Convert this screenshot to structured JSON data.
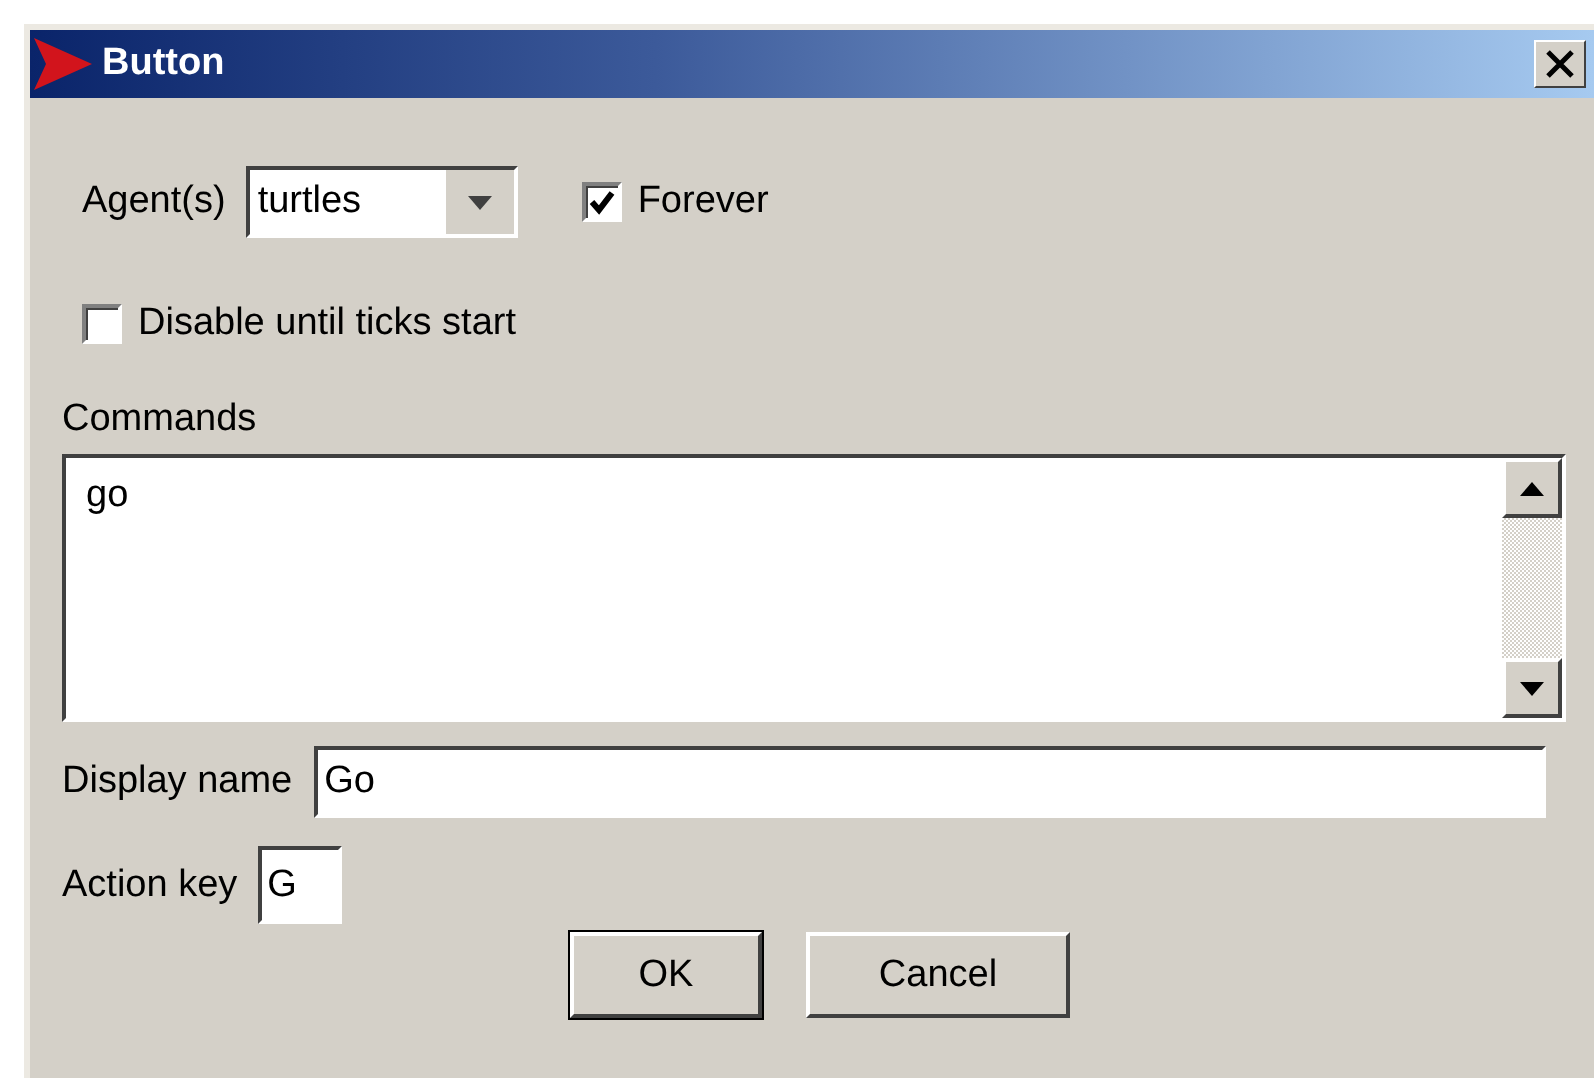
{
  "window": {
    "title": "Button"
  },
  "agents": {
    "label": "Agent(s)",
    "value": "turtles"
  },
  "forever": {
    "label": "Forever",
    "checked": true
  },
  "disable_until_ticks": {
    "label": "Disable until ticks start",
    "checked": false
  },
  "commands": {
    "label": "Commands",
    "value": "go"
  },
  "display_name": {
    "label": "Display name",
    "value": "Go"
  },
  "action_key": {
    "label": "Action key",
    "value": "G"
  },
  "buttons": [
    {
      "label": "OK",
      "default": true
    },
    {
      "label": "Cancel",
      "default": false
    }
  ]
}
